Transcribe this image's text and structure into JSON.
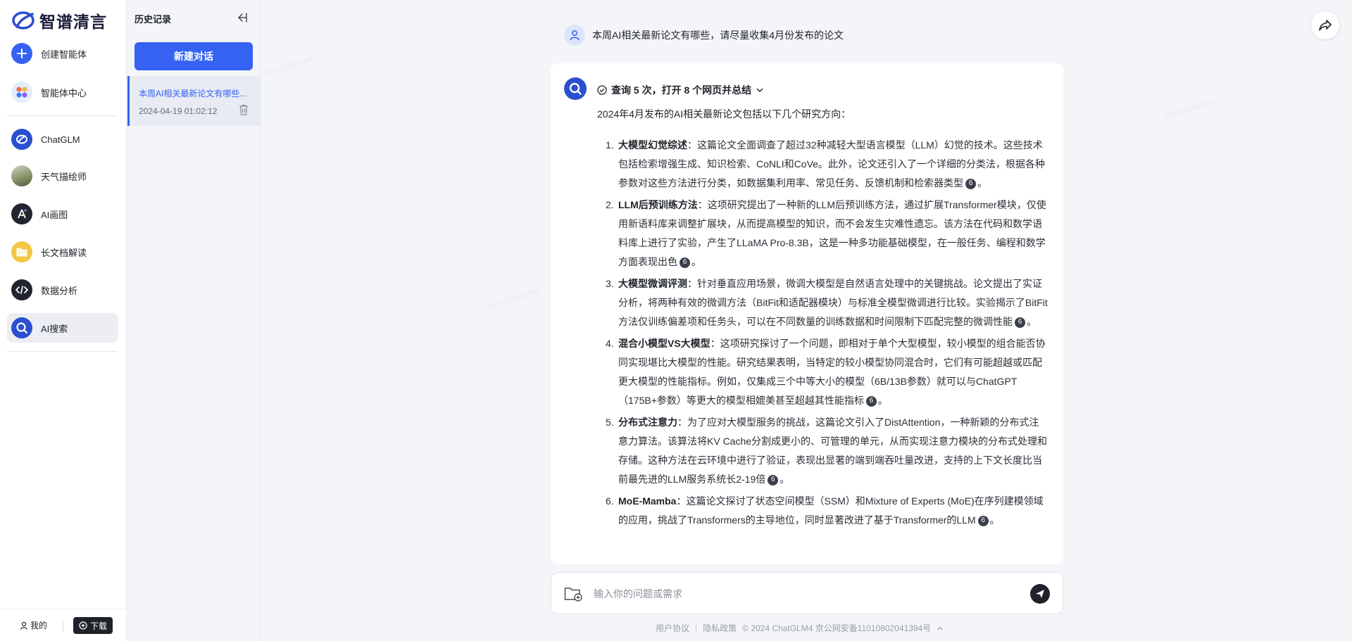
{
  "brand": {
    "name": "智谱清言"
  },
  "nav": {
    "items": [
      {
        "label": "创建智能体",
        "icon": "plus-icon",
        "color": "#3562f2"
      },
      {
        "label": "智能体中心",
        "icon": "apps-icon",
        "color": "#e2edfd"
      },
      {
        "label": "ChatGLM",
        "icon": "chatglm-logo-icon",
        "color": "#2a4fcf"
      },
      {
        "label": "天气描绘师",
        "icon": "weather-avatar-icon",
        "color": "#8a9468"
      },
      {
        "label": "AI画图",
        "icon": "ai-draw-icon",
        "color": "#22252e"
      },
      {
        "label": "长文档解读",
        "icon": "document-icon",
        "color": "#f2c744"
      },
      {
        "label": "数据分析",
        "icon": "code-icon",
        "color": "#22252e"
      },
      {
        "label": "AI搜索",
        "icon": "ai-search-icon",
        "color": "#2a4fcf"
      }
    ],
    "me_label": "我的",
    "download_label": "下载"
  },
  "history": {
    "title": "历史记录",
    "new_chat_label": "新建对话",
    "items": [
      {
        "title": "本周AI相关最新论文有哪些...",
        "date": "2024-04-19 01:02:12"
      }
    ]
  },
  "chat": {
    "user_message": "本周AI相关最新论文有哪些，请尽量收集4月份发布的论文",
    "search_summary": "查询 5 次，打开 8 个网页并总结",
    "intro": "2024年4月发布的AI相关最新论文包括以下几个研究方向：",
    "cite_label": "6",
    "items": [
      {
        "num": "1.",
        "title": "大模型幻觉综述",
        "text": "：这篇论文全面调查了超过32种减轻大型语言模型（LLM）幻觉的技术。这些技术包括检索增强生成、知识检索、CoNLI和CoVe。此外，论文还引入了一个详细的分类法，根据各种参数对这些方法进行分类，如数据集利用率、常见任务、反馈机制和检索器类型",
        "end": "。"
      },
      {
        "num": "2.",
        "title": "LLM后预训练方法",
        "text": "：这项研究提出了一种新的LLM后预训练方法，通过扩展Transformer模块，仅使用新语料库来调整扩展块，从而提高模型的知识，而不会发生灾难性遗忘。该方法在代码和数学语料库上进行了实验，产生了LLaMA Pro-8.3B，这是一种多功能基础模型，在一般任务、编程和数学方面表现出色",
        "end": "。"
      },
      {
        "num": "3.",
        "title": "大模型微调评测",
        "text": "：针对垂直应用场景，微调大模型是自然语言处理中的关键挑战。论文提出了实证分析，将两种有效的微调方法（BitFit和适配器模块）与标准全模型微调进行比较。实验揭示了BitFit方法仅训练偏差项和任务头，可以在不同数量的训练数据和时间限制下匹配完整的微调性能",
        "end": "。"
      },
      {
        "num": "4.",
        "title": "混合小模型VS大模型",
        "text": "：这项研究探讨了一个问题，即相对于单个大型模型，较小模型的组合能否协同实现堪比大模型的性能。研究结果表明，当特定的较小模型协同混合时，它们有可能超越或匹配更大模型的性能指标。例如，仅集成三个中等大小的模型（6B/13B参数）就可以与ChatGPT（175B+参数）等更大的模型相媲美甚至超越其性能指标",
        "end": "。"
      },
      {
        "num": "5.",
        "title": "分布式注意力",
        "text": "：为了应对大模型服务的挑战，这篇论文引入了DistAttention，一种新颖的分布式注意力算法。该算法将KV Cache分割成更小的、可管理的单元，从而实现注意力模块的分布式处理和存储。这种方法在云环境中进行了验证，表现出显著的端到端吞吐量改进，支持的上下文长度比当前最先进的LLM服务系统长2-19倍",
        "end": "。"
      },
      {
        "num": "6.",
        "title": "MoE-Mamba",
        "text": "：这篇论文探讨了状态空间模型（SSM）和Mixture of Experts (MoE)在序列建模领域的应用，挑战了Transformers的主导地位，同时显著改进了基于Transformer的LLM",
        "end": "。"
      }
    ]
  },
  "composer": {
    "placeholder": "输入你的问题或需求"
  },
  "footer": {
    "terms": "用户协议",
    "privacy": "隐私政策",
    "copyright": "© 2024 ChatGLM4 京公网安备11010802041394号"
  },
  "colors": {
    "accent": "#3562f2",
    "dark": "#1f2329"
  }
}
